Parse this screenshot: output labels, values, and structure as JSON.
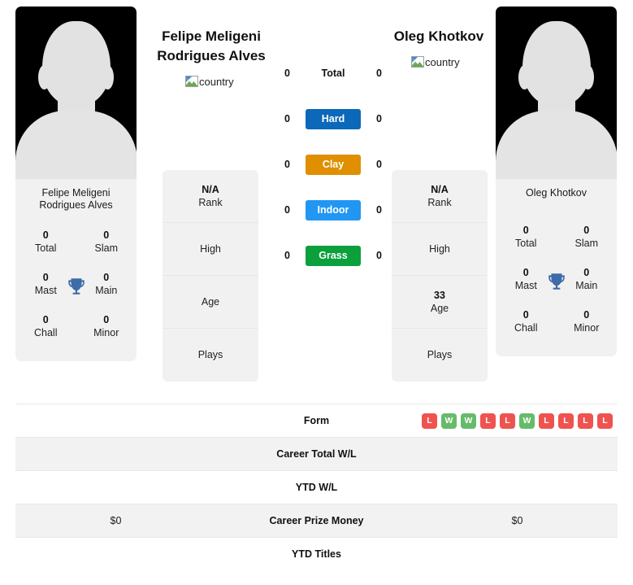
{
  "players": {
    "left": {
      "heading": "Felipe Meligeni Rodrigues Alves",
      "heading_line1": "Felipe Meligeni",
      "heading_line2": "Rodrigues Alves",
      "country_alt": "country",
      "card_name": "Felipe Meligeni Rodrigues Alves",
      "titles": [
        {
          "value": "0",
          "label": "Total"
        },
        {
          "value": "0",
          "label": "Slam"
        },
        {
          "value": "0",
          "label": "Mast"
        },
        {
          "value": "0",
          "label": "Main"
        },
        {
          "value": "0",
          "label": "Chall"
        },
        {
          "value": "0",
          "label": "Minor"
        }
      ],
      "info": [
        {
          "value": "N/A",
          "label": "Rank"
        },
        {
          "value": "",
          "label": "High"
        },
        {
          "value": "",
          "label": "Age"
        },
        {
          "value": "",
          "label": "Plays"
        }
      ],
      "prize_money": "$0"
    },
    "right": {
      "heading": "Oleg Khotkov",
      "heading_line1": "Oleg Khotkov",
      "heading_line2": "",
      "country_alt": "country",
      "card_name": "Oleg Khotkov",
      "titles": [
        {
          "value": "0",
          "label": "Total"
        },
        {
          "value": "0",
          "label": "Slam"
        },
        {
          "value": "0",
          "label": "Mast"
        },
        {
          "value": "0",
          "label": "Main"
        },
        {
          "value": "0",
          "label": "Chall"
        },
        {
          "value": "0",
          "label": "Minor"
        }
      ],
      "info": [
        {
          "value": "N/A",
          "label": "Rank"
        },
        {
          "value": "",
          "label": "High"
        },
        {
          "value": "33",
          "label": "Age"
        },
        {
          "value": "",
          "label": "Plays"
        }
      ],
      "prize_money": "$0"
    }
  },
  "surfaces": [
    {
      "label": "Total",
      "left_value": "0",
      "right_value": "0",
      "color": ""
    },
    {
      "label": "Hard",
      "left_value": "0",
      "right_value": "0",
      "color": "#0c68b8"
    },
    {
      "label": "Clay",
      "left_value": "0",
      "right_value": "0",
      "color": "#df8f00"
    },
    {
      "label": "Indoor",
      "left_value": "0",
      "right_value": "0",
      "color": "#2196f3"
    },
    {
      "label": "Grass",
      "left_value": "0",
      "right_value": "0",
      "color": "#0ba03c"
    }
  ],
  "table": {
    "form_label": "Form",
    "form_badges": [
      "L",
      "W",
      "W",
      "L",
      "L",
      "W",
      "L",
      "L",
      "L",
      "L"
    ],
    "rows": [
      {
        "left": "",
        "label": "Career Total W/L",
        "right": ""
      },
      {
        "left": "",
        "label": "YTD W/L",
        "right": ""
      },
      {
        "left": "$0",
        "label": "Career Prize Money",
        "right": "$0"
      },
      {
        "left": "",
        "label": "YTD Titles",
        "right": ""
      }
    ]
  },
  "colors": {
    "win": "#66bb6a",
    "loss": "#ef5350",
    "trophy": "#3d6ca8",
    "panel_bg": "#f1f1f1",
    "row_shade": "#f2f2f2"
  }
}
